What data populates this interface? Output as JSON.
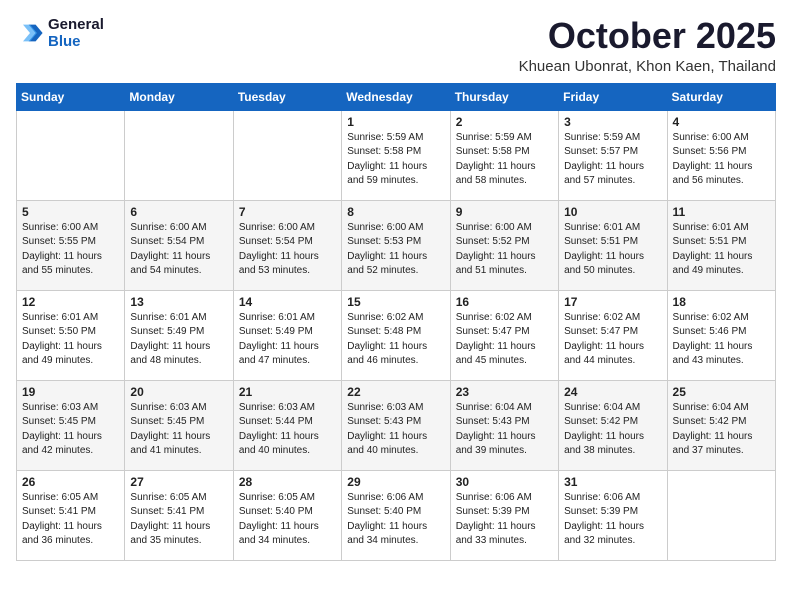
{
  "logo": {
    "line1": "General",
    "line2": "Blue"
  },
  "title": "October 2025",
  "location": "Khuean Ubonrat, Khon Kaen, Thailand",
  "headers": [
    "Sunday",
    "Monday",
    "Tuesday",
    "Wednesday",
    "Thursday",
    "Friday",
    "Saturday"
  ],
  "weeks": [
    [
      {
        "day": "",
        "info": ""
      },
      {
        "day": "",
        "info": ""
      },
      {
        "day": "",
        "info": ""
      },
      {
        "day": "1",
        "info": "Sunrise: 5:59 AM\nSunset: 5:58 PM\nDaylight: 11 hours\nand 59 minutes."
      },
      {
        "day": "2",
        "info": "Sunrise: 5:59 AM\nSunset: 5:58 PM\nDaylight: 11 hours\nand 58 minutes."
      },
      {
        "day": "3",
        "info": "Sunrise: 5:59 AM\nSunset: 5:57 PM\nDaylight: 11 hours\nand 57 minutes."
      },
      {
        "day": "4",
        "info": "Sunrise: 6:00 AM\nSunset: 5:56 PM\nDaylight: 11 hours\nand 56 minutes."
      }
    ],
    [
      {
        "day": "5",
        "info": "Sunrise: 6:00 AM\nSunset: 5:55 PM\nDaylight: 11 hours\nand 55 minutes."
      },
      {
        "day": "6",
        "info": "Sunrise: 6:00 AM\nSunset: 5:54 PM\nDaylight: 11 hours\nand 54 minutes."
      },
      {
        "day": "7",
        "info": "Sunrise: 6:00 AM\nSunset: 5:54 PM\nDaylight: 11 hours\nand 53 minutes."
      },
      {
        "day": "8",
        "info": "Sunrise: 6:00 AM\nSunset: 5:53 PM\nDaylight: 11 hours\nand 52 minutes."
      },
      {
        "day": "9",
        "info": "Sunrise: 6:00 AM\nSunset: 5:52 PM\nDaylight: 11 hours\nand 51 minutes."
      },
      {
        "day": "10",
        "info": "Sunrise: 6:01 AM\nSunset: 5:51 PM\nDaylight: 11 hours\nand 50 minutes."
      },
      {
        "day": "11",
        "info": "Sunrise: 6:01 AM\nSunset: 5:51 PM\nDaylight: 11 hours\nand 49 minutes."
      }
    ],
    [
      {
        "day": "12",
        "info": "Sunrise: 6:01 AM\nSunset: 5:50 PM\nDaylight: 11 hours\nand 49 minutes."
      },
      {
        "day": "13",
        "info": "Sunrise: 6:01 AM\nSunset: 5:49 PM\nDaylight: 11 hours\nand 48 minutes."
      },
      {
        "day": "14",
        "info": "Sunrise: 6:01 AM\nSunset: 5:49 PM\nDaylight: 11 hours\nand 47 minutes."
      },
      {
        "day": "15",
        "info": "Sunrise: 6:02 AM\nSunset: 5:48 PM\nDaylight: 11 hours\nand 46 minutes."
      },
      {
        "day": "16",
        "info": "Sunrise: 6:02 AM\nSunset: 5:47 PM\nDaylight: 11 hours\nand 45 minutes."
      },
      {
        "day": "17",
        "info": "Sunrise: 6:02 AM\nSunset: 5:47 PM\nDaylight: 11 hours\nand 44 minutes."
      },
      {
        "day": "18",
        "info": "Sunrise: 6:02 AM\nSunset: 5:46 PM\nDaylight: 11 hours\nand 43 minutes."
      }
    ],
    [
      {
        "day": "19",
        "info": "Sunrise: 6:03 AM\nSunset: 5:45 PM\nDaylight: 11 hours\nand 42 minutes."
      },
      {
        "day": "20",
        "info": "Sunrise: 6:03 AM\nSunset: 5:45 PM\nDaylight: 11 hours\nand 41 minutes."
      },
      {
        "day": "21",
        "info": "Sunrise: 6:03 AM\nSunset: 5:44 PM\nDaylight: 11 hours\nand 40 minutes."
      },
      {
        "day": "22",
        "info": "Sunrise: 6:03 AM\nSunset: 5:43 PM\nDaylight: 11 hours\nand 40 minutes."
      },
      {
        "day": "23",
        "info": "Sunrise: 6:04 AM\nSunset: 5:43 PM\nDaylight: 11 hours\nand 39 minutes."
      },
      {
        "day": "24",
        "info": "Sunrise: 6:04 AM\nSunset: 5:42 PM\nDaylight: 11 hours\nand 38 minutes."
      },
      {
        "day": "25",
        "info": "Sunrise: 6:04 AM\nSunset: 5:42 PM\nDaylight: 11 hours\nand 37 minutes."
      }
    ],
    [
      {
        "day": "26",
        "info": "Sunrise: 6:05 AM\nSunset: 5:41 PM\nDaylight: 11 hours\nand 36 minutes."
      },
      {
        "day": "27",
        "info": "Sunrise: 6:05 AM\nSunset: 5:41 PM\nDaylight: 11 hours\nand 35 minutes."
      },
      {
        "day": "28",
        "info": "Sunrise: 6:05 AM\nSunset: 5:40 PM\nDaylight: 11 hours\nand 34 minutes."
      },
      {
        "day": "29",
        "info": "Sunrise: 6:06 AM\nSunset: 5:40 PM\nDaylight: 11 hours\nand 34 minutes."
      },
      {
        "day": "30",
        "info": "Sunrise: 6:06 AM\nSunset: 5:39 PM\nDaylight: 11 hours\nand 33 minutes."
      },
      {
        "day": "31",
        "info": "Sunrise: 6:06 AM\nSunset: 5:39 PM\nDaylight: 11 hours\nand 32 minutes."
      },
      {
        "day": "",
        "info": ""
      }
    ]
  ]
}
